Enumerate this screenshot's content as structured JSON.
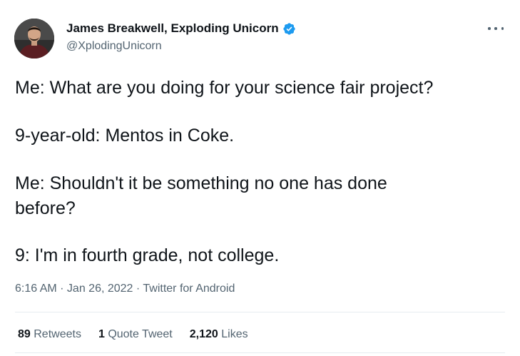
{
  "author": {
    "name": "James Breakwell, Exploding Unicorn",
    "handle": "@XplodingUnicorn",
    "verified": true,
    "verified_color": "#1d9bf0"
  },
  "tweet": {
    "lines": [
      "Me: What are you doing for your science fair project?",
      "9-year-old: Mentos in Coke.",
      "Me: Shouldn't it be something no one has done",
      "before?",
      "9: I'm in fourth grade, not college."
    ],
    "time": "6:16 AM",
    "date": "Jan 26, 2022",
    "source": "Twitter for Android",
    "separator": " · "
  },
  "stats": {
    "retweets_count": "89",
    "retweets_label": "Retweets",
    "quotes_count": "1",
    "quotes_label": "Quote Tweet",
    "likes_count": "2,120",
    "likes_label": "Likes"
  },
  "icons": {
    "verified": "verified-badge-icon",
    "more": "more-options-icon",
    "avatar": "profile-photo"
  }
}
